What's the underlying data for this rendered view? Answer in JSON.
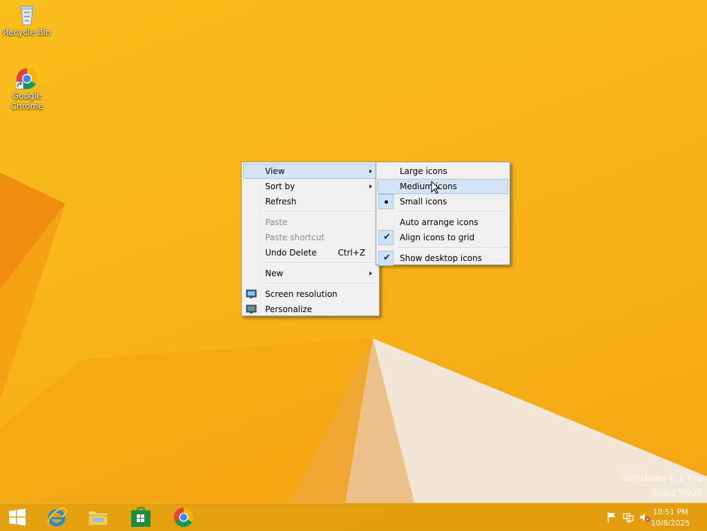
{
  "desktop": {
    "icons": [
      {
        "label": "Recycle Bin",
        "icon": "recycle-bin-icon"
      },
      {
        "label": "Google Chrome",
        "icon": "chrome-icon"
      }
    ],
    "watermark": {
      "line1": "Windows 8.1 Pro",
      "line2": "Build 9600"
    }
  },
  "context_menu": {
    "items": [
      {
        "label": "View",
        "submenu": true,
        "highlighted": true
      },
      {
        "label": "Sort by",
        "submenu": true
      },
      {
        "label": "Refresh"
      },
      {
        "label": "Paste",
        "disabled": true
      },
      {
        "label": "Paste shortcut",
        "disabled": true
      },
      {
        "label": "Undo Delete",
        "accelerator": "Ctrl+Z"
      },
      {
        "label": "New",
        "submenu": true
      },
      {
        "label": "Screen resolution",
        "icon": "screen-resolution-icon"
      },
      {
        "label": "Personalize",
        "icon": "personalize-icon"
      }
    ]
  },
  "view_submenu": {
    "items": [
      {
        "label": "Large icons"
      },
      {
        "label": "Medium icons",
        "highlighted": true
      },
      {
        "label": "Small icons",
        "selected": true
      },
      {
        "label": "Auto arrange icons"
      },
      {
        "label": "Align icons to grid",
        "checked": true
      },
      {
        "label": "Show desktop icons",
        "checked": true
      }
    ]
  },
  "taskbar": {
    "buttons": [
      {
        "name": "start-button",
        "icon": "windows-logo-icon"
      },
      {
        "name": "internet-explorer",
        "icon": "ie-icon"
      },
      {
        "name": "file-explorer",
        "icon": "folder-icon"
      },
      {
        "name": "store",
        "icon": "store-icon"
      },
      {
        "name": "google-chrome",
        "icon": "chrome-icon"
      }
    ],
    "tray": {
      "icons": [
        "action-center-flag-icon",
        "network-icon",
        "volume-muted-icon"
      ],
      "time": "10:51 PM",
      "date": "10/8/2025"
    }
  },
  "colors": {
    "wallpaper": "#f7b419",
    "menu_bg": "#f0f0f0",
    "menu_highlight": "#d5e4f4"
  }
}
